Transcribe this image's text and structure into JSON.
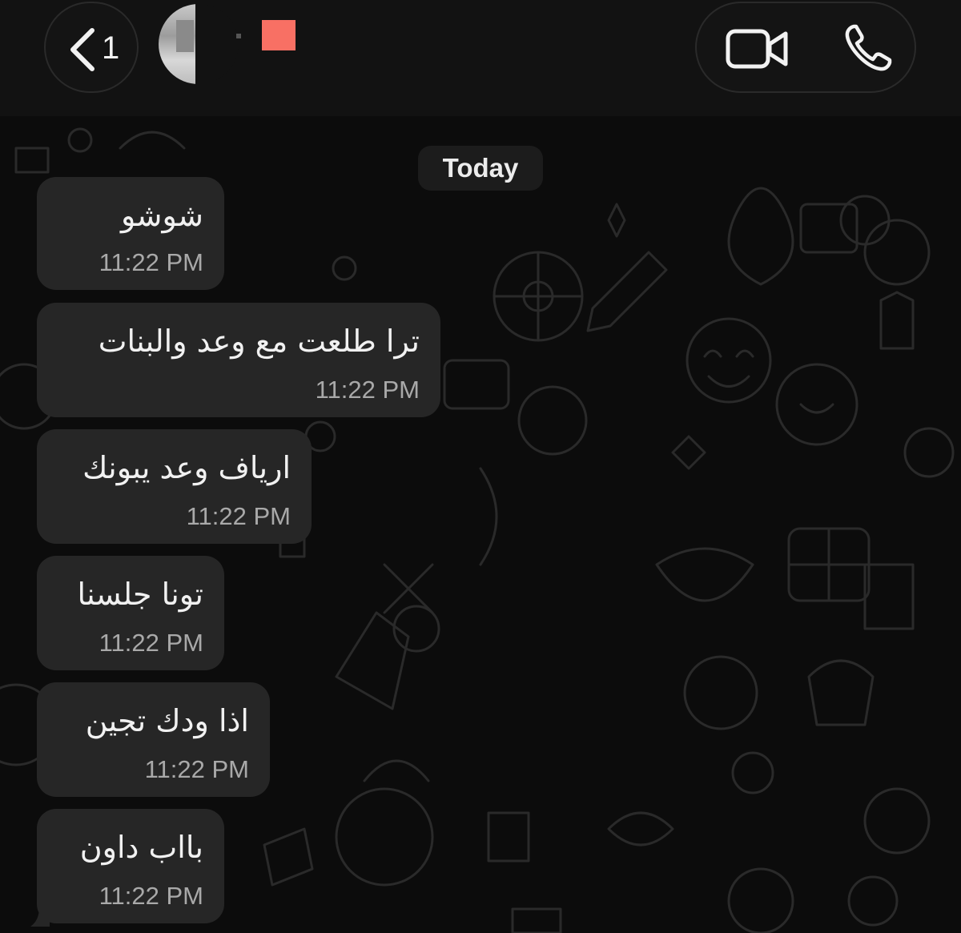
{
  "header": {
    "back_count": "1",
    "back_icon": "chevron-left-icon",
    "video_icon": "video-camera-icon",
    "phone_icon": "phone-icon",
    "name_color": "#f87064"
  },
  "chat": {
    "date_label": "Today",
    "bubble_color": "#262626",
    "messages": [
      {
        "text": "شوشو",
        "time": "11:22 PM"
      },
      {
        "text": "ترا طلعت مع وعد والبنات",
        "time": "11:22 PM"
      },
      {
        "text": "ارياف وعد يبونك",
        "time": "11:22 PM"
      },
      {
        "text": "تونا جلسنا",
        "time": "11:22 PM"
      },
      {
        "text": "اذا ودك تجين",
        "time": "11:22 PM"
      },
      {
        "text": "بااب داون",
        "time": "11:22 PM"
      }
    ]
  }
}
